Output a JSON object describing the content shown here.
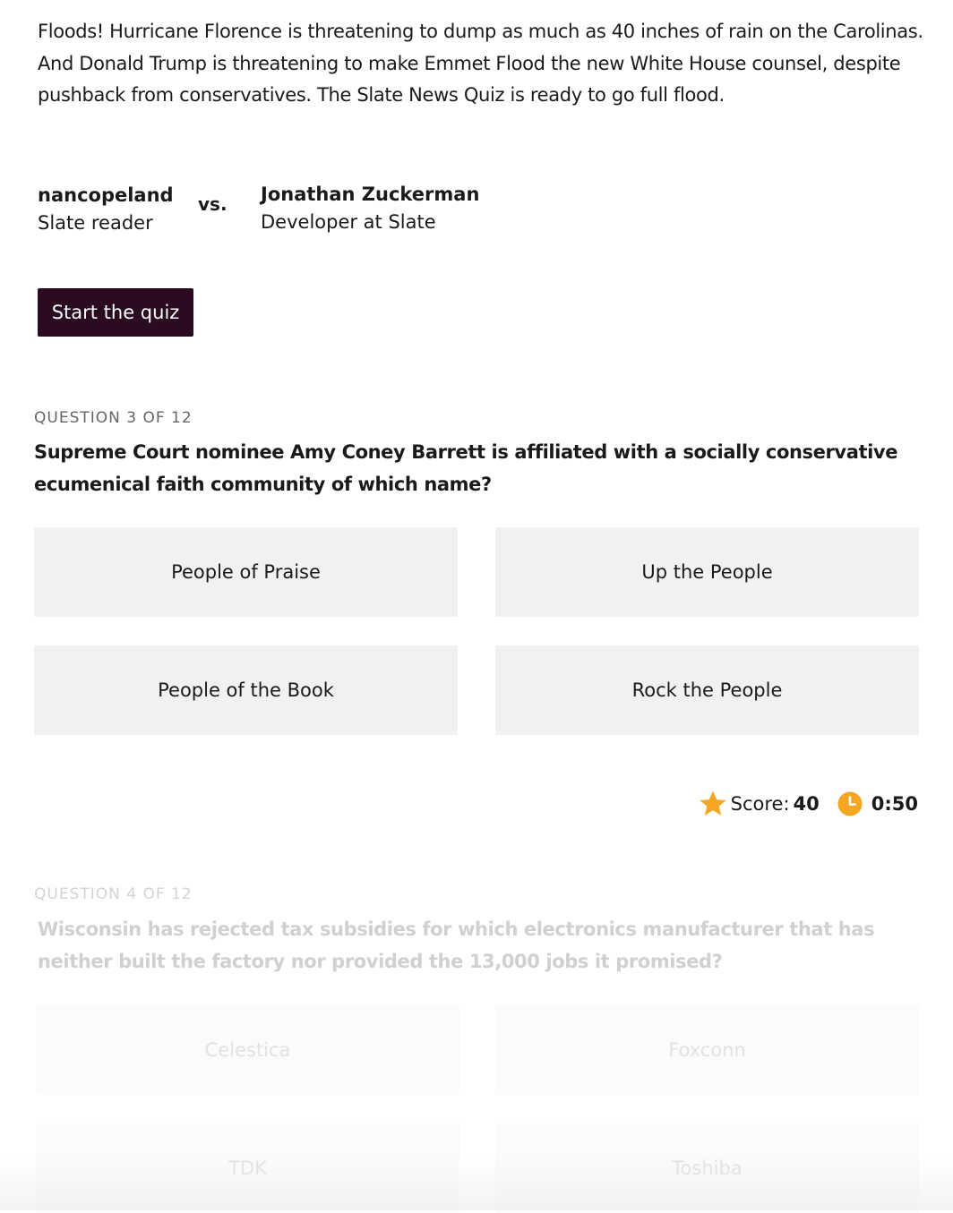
{
  "intro": {
    "text": "Floods! Hurricane Florence is threatening to dump as much as 40 inches of rain on the Carolinas. And Donald Trump is threatening to make Emmet Flood the new White House counsel, despite pushback from conservatives. The Slate News Quiz is ready to go full flood."
  },
  "matchup": {
    "player1": {
      "name": "nancopeland",
      "role": "Slate reader"
    },
    "vs_label": "vs.",
    "player2": {
      "name": "Jonathan Zuckerman",
      "role": "Developer at Slate"
    }
  },
  "start_button": {
    "label": "Start the quiz"
  },
  "question3": {
    "label": "QUESTION 3 OF 12",
    "text": "Supreme Court nominee Amy Coney Barrett is affiliated with a socially conservative ecumenical faith community of which name?",
    "answers": [
      "People of Praise",
      "Up the People",
      "People of the Book",
      "Rock the People"
    ]
  },
  "status": {
    "score_label": "Score:",
    "score_value": "40",
    "timer": "0:50",
    "star_color": "#f5a623",
    "clock_color": "#f5a623",
    "star_icon": "star-icon",
    "clock_icon": "clock-icon"
  },
  "question4": {
    "label": "QUESTION 4 OF 12",
    "text": "Wisconsin has rejected tax subsidies for which electronics manufacturer that has neither built the factory nor provided the 13,000 jobs it promised?",
    "answers": [
      "Celestica",
      "Foxconn",
      "TDK",
      "Toshiba"
    ]
  },
  "colors": {
    "start_button_bg": "#2a0b21",
    "answer_bg": "#f1f1f1"
  }
}
